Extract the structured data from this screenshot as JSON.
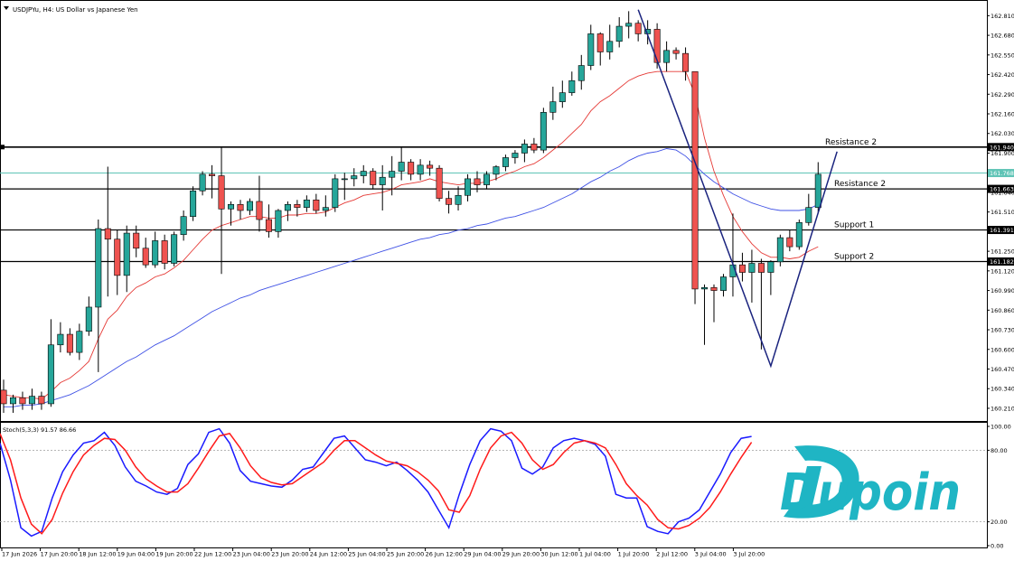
{
  "chart_data": [
    {
      "type": "candlestick",
      "title": "USDJPYu, H4: US Dollar vs Japanese Yen",
      "ylim": [
        160.12,
        162.89
      ],
      "y_ticks": [
        "162.810",
        "162.680",
        "162.550",
        "162.420",
        "162.290",
        "162.160",
        "162.030",
        "161.900",
        "161.640",
        "161.510",
        "161.380",
        "161.250",
        "161.120",
        "160.990",
        "160.860",
        "160.730",
        "160.600",
        "160.470",
        "160.340",
        "160.210"
      ],
      "x_ticks": [
        "17 Jun 2026",
        "17 Jun 20:00",
        "18 Jun 12:00",
        "19 Jun 04:00",
        "19 Jun 20:00",
        "22 Jun 12:00",
        "23 Jun 04:00",
        "23 Jun 20:00",
        "24 Jun 12:00",
        "25 Jun 04:00",
        "25 Jun 20:00",
        "26 Jun 12:00",
        "29 Jun 04:00",
        "29 Jun 20:00",
        "30 Jun 12:00",
        "1 Jul 04:00",
        "1 Jul 20:00",
        "2 Jul 12:00",
        "3 Jul 04:00",
        "3 Jul 20:00"
      ],
      "candles": [
        {
          "o": 160.33,
          "h": 160.4,
          "l": 160.18,
          "c": 160.24
        },
        {
          "o": 160.24,
          "h": 160.3,
          "l": 160.18,
          "c": 160.28
        },
        {
          "o": 160.28,
          "h": 160.32,
          "l": 160.2,
          "c": 160.24
        },
        {
          "o": 160.24,
          "h": 160.34,
          "l": 160.2,
          "c": 160.29
        },
        {
          "o": 160.29,
          "h": 160.32,
          "l": 160.2,
          "c": 160.24
        },
        {
          "o": 160.24,
          "h": 160.8,
          "l": 160.22,
          "c": 160.63
        },
        {
          "o": 160.63,
          "h": 160.78,
          "l": 160.58,
          "c": 160.7
        },
        {
          "o": 160.7,
          "h": 160.74,
          "l": 160.56,
          "c": 160.58
        },
        {
          "o": 160.58,
          "h": 160.77,
          "l": 160.53,
          "c": 160.72
        },
        {
          "o": 160.72,
          "h": 160.95,
          "l": 160.69,
          "c": 160.88
        },
        {
          "o": 160.88,
          "h": 161.46,
          "l": 160.45,
          "c": 161.4
        },
        {
          "o": 161.4,
          "h": 161.81,
          "l": 160.95,
          "c": 161.33
        },
        {
          "o": 161.33,
          "h": 161.39,
          "l": 160.96,
          "c": 161.09
        },
        {
          "o": 161.09,
          "h": 161.42,
          "l": 160.98,
          "c": 161.37
        },
        {
          "o": 161.37,
          "h": 161.42,
          "l": 161.21,
          "c": 161.27
        },
        {
          "o": 161.27,
          "h": 161.34,
          "l": 161.14,
          "c": 161.16
        },
        {
          "o": 161.16,
          "h": 161.38,
          "l": 161.14,
          "c": 161.32
        },
        {
          "o": 161.32,
          "h": 161.36,
          "l": 161.13,
          "c": 161.17
        },
        {
          "o": 161.17,
          "h": 161.38,
          "l": 161.15,
          "c": 161.36
        },
        {
          "o": 161.36,
          "h": 161.52,
          "l": 161.32,
          "c": 161.48
        },
        {
          "o": 161.48,
          "h": 161.68,
          "l": 161.45,
          "c": 161.65
        },
        {
          "o": 161.65,
          "h": 161.78,
          "l": 161.62,
          "c": 161.76
        },
        {
          "o": 161.76,
          "h": 161.82,
          "l": 161.6,
          "c": 161.75
        },
        {
          "o": 161.75,
          "h": 161.94,
          "l": 161.1,
          "c": 161.53
        },
        {
          "o": 161.53,
          "h": 161.58,
          "l": 161.42,
          "c": 161.56
        },
        {
          "o": 161.56,
          "h": 161.59,
          "l": 161.46,
          "c": 161.52
        },
        {
          "o": 161.52,
          "h": 161.6,
          "l": 161.49,
          "c": 161.58
        },
        {
          "o": 161.58,
          "h": 161.75,
          "l": 161.38,
          "c": 161.46
        },
        {
          "o": 161.46,
          "h": 161.56,
          "l": 161.34,
          "c": 161.38
        },
        {
          "o": 161.38,
          "h": 161.53,
          "l": 161.34,
          "c": 161.52
        },
        {
          "o": 161.52,
          "h": 161.58,
          "l": 161.45,
          "c": 161.56
        },
        {
          "o": 161.56,
          "h": 161.59,
          "l": 161.48,
          "c": 161.54
        },
        {
          "o": 161.54,
          "h": 161.62,
          "l": 161.51,
          "c": 161.59
        },
        {
          "o": 161.59,
          "h": 161.63,
          "l": 161.5,
          "c": 161.52
        },
        {
          "o": 161.52,
          "h": 161.62,
          "l": 161.48,
          "c": 161.54
        },
        {
          "o": 161.54,
          "h": 161.76,
          "l": 161.51,
          "c": 161.73
        },
        {
          "o": 161.73,
          "h": 161.77,
          "l": 161.59,
          "c": 161.73
        },
        {
          "o": 161.73,
          "h": 161.8,
          "l": 161.68,
          "c": 161.75
        },
        {
          "o": 161.75,
          "h": 161.82,
          "l": 161.7,
          "c": 161.78
        },
        {
          "o": 161.78,
          "h": 161.8,
          "l": 161.66,
          "c": 161.69
        },
        {
          "o": 161.69,
          "h": 161.82,
          "l": 161.52,
          "c": 161.74
        },
        {
          "o": 161.74,
          "h": 161.88,
          "l": 161.62,
          "c": 161.78
        },
        {
          "o": 161.78,
          "h": 161.94,
          "l": 161.72,
          "c": 161.84
        },
        {
          "o": 161.84,
          "h": 161.86,
          "l": 161.72,
          "c": 161.76
        },
        {
          "o": 161.76,
          "h": 161.86,
          "l": 161.72,
          "c": 161.82
        },
        {
          "o": 161.82,
          "h": 161.85,
          "l": 161.75,
          "c": 161.8
        },
        {
          "o": 161.8,
          "h": 161.82,
          "l": 161.58,
          "c": 161.6
        },
        {
          "o": 161.6,
          "h": 161.65,
          "l": 161.5,
          "c": 161.56
        },
        {
          "o": 161.56,
          "h": 161.68,
          "l": 161.52,
          "c": 161.62
        },
        {
          "o": 161.62,
          "h": 161.76,
          "l": 161.58,
          "c": 161.73
        },
        {
          "o": 161.73,
          "h": 161.78,
          "l": 161.64,
          "c": 161.69
        },
        {
          "o": 161.69,
          "h": 161.78,
          "l": 161.66,
          "c": 161.76
        },
        {
          "o": 161.76,
          "h": 161.82,
          "l": 161.72,
          "c": 161.81
        },
        {
          "o": 161.81,
          "h": 161.89,
          "l": 161.78,
          "c": 161.87
        },
        {
          "o": 161.87,
          "h": 161.92,
          "l": 161.83,
          "c": 161.9
        },
        {
          "o": 161.9,
          "h": 161.99,
          "l": 161.84,
          "c": 161.96
        },
        {
          "o": 161.96,
          "h": 162.0,
          "l": 161.9,
          "c": 161.92
        },
        {
          "o": 161.92,
          "h": 162.2,
          "l": 161.9,
          "c": 162.17
        },
        {
          "o": 162.17,
          "h": 162.34,
          "l": 162.12,
          "c": 162.24
        },
        {
          "o": 162.24,
          "h": 162.38,
          "l": 162.2,
          "c": 162.3
        },
        {
          "o": 162.3,
          "h": 162.44,
          "l": 162.28,
          "c": 162.38
        },
        {
          "o": 162.38,
          "h": 162.55,
          "l": 162.32,
          "c": 162.48
        },
        {
          "o": 162.48,
          "h": 162.75,
          "l": 162.45,
          "c": 162.69
        },
        {
          "o": 162.69,
          "h": 162.7,
          "l": 162.48,
          "c": 162.57
        },
        {
          "o": 162.57,
          "h": 162.75,
          "l": 162.52,
          "c": 162.64
        },
        {
          "o": 162.64,
          "h": 162.8,
          "l": 162.6,
          "c": 162.74
        },
        {
          "o": 162.74,
          "h": 162.84,
          "l": 162.66,
          "c": 162.76
        },
        {
          "o": 162.76,
          "h": 162.78,
          "l": 162.64,
          "c": 162.69
        },
        {
          "o": 162.69,
          "h": 162.78,
          "l": 162.62,
          "c": 162.72
        },
        {
          "o": 162.72,
          "h": 162.76,
          "l": 162.46,
          "c": 162.5
        },
        {
          "o": 162.5,
          "h": 162.64,
          "l": 162.44,
          "c": 162.58
        },
        {
          "o": 162.58,
          "h": 162.6,
          "l": 162.52,
          "c": 162.56
        },
        {
          "o": 162.56,
          "h": 162.6,
          "l": 162.38,
          "c": 162.44
        },
        {
          "o": 162.44,
          "h": 162.4,
          "l": 160.9,
          "c": 161.0
        },
        {
          "o": 161.0,
          "h": 161.03,
          "l": 160.63,
          "c": 161.01
        },
        {
          "o": 161.01,
          "h": 161.03,
          "l": 160.78,
          "c": 160.99
        },
        {
          "o": 160.99,
          "h": 161.1,
          "l": 160.95,
          "c": 161.08
        },
        {
          "o": 161.08,
          "h": 161.5,
          "l": 160.95,
          "c": 161.16
        },
        {
          "o": 161.16,
          "h": 161.24,
          "l": 161.05,
          "c": 161.11
        },
        {
          "o": 161.11,
          "h": 161.26,
          "l": 160.91,
          "c": 161.17
        },
        {
          "o": 161.17,
          "h": 161.2,
          "l": 160.6,
          "c": 161.11
        },
        {
          "o": 161.11,
          "h": 161.19,
          "l": 160.96,
          "c": 161.18
        },
        {
          "o": 161.18,
          "h": 161.36,
          "l": 161.15,
          "c": 161.34
        },
        {
          "o": 161.34,
          "h": 161.39,
          "l": 161.25,
          "c": 161.28
        },
        {
          "o": 161.28,
          "h": 161.46,
          "l": 161.26,
          "c": 161.44
        },
        {
          "o": 161.44,
          "h": 161.63,
          "l": 161.42,
          "c": 161.54
        },
        {
          "o": 161.54,
          "h": 161.84,
          "l": 161.5,
          "c": 161.76
        }
      ],
      "ema_fast": [
        160.3,
        160.29,
        160.28,
        160.28,
        160.27,
        160.32,
        160.38,
        160.41,
        160.46,
        160.52,
        160.67,
        160.8,
        160.86,
        160.95,
        161.01,
        161.04,
        161.08,
        161.1,
        161.14,
        161.19,
        161.26,
        161.33,
        161.39,
        161.42,
        161.44,
        161.46,
        161.48,
        161.48,
        161.47,
        161.47,
        161.49,
        161.49,
        161.5,
        161.5,
        161.51,
        161.54,
        161.57,
        161.59,
        161.62,
        161.63,
        161.64,
        161.66,
        161.69,
        161.7,
        161.71,
        161.73,
        161.71,
        161.7,
        161.69,
        161.7,
        161.7,
        161.71,
        161.73,
        161.76,
        161.78,
        161.81,
        161.83,
        161.87,
        161.92,
        161.97,
        162.03,
        162.09,
        162.18,
        162.24,
        162.28,
        162.33,
        162.38,
        162.41,
        162.43,
        162.44,
        162.44,
        162.44,
        162.44,
        162.29,
        162.0,
        161.78,
        161.62,
        161.48,
        161.38,
        161.3,
        161.24,
        161.21,
        161.21,
        161.2,
        161.21,
        161.25,
        161.28
      ],
      "ema_slow": [
        160.22,
        160.22,
        160.23,
        160.23,
        160.24,
        160.26,
        160.28,
        160.3,
        160.33,
        160.36,
        160.4,
        160.44,
        160.48,
        160.52,
        160.55,
        160.59,
        160.63,
        160.66,
        160.69,
        160.73,
        160.77,
        160.81,
        160.85,
        160.88,
        160.91,
        160.94,
        160.96,
        160.99,
        161.01,
        161.03,
        161.05,
        161.07,
        161.09,
        161.11,
        161.13,
        161.15,
        161.17,
        161.19,
        161.21,
        161.23,
        161.25,
        161.27,
        161.29,
        161.31,
        161.33,
        161.34,
        161.36,
        161.37,
        161.39,
        161.4,
        161.42,
        161.43,
        161.45,
        161.47,
        161.48,
        161.5,
        161.52,
        161.54,
        161.57,
        161.6,
        161.63,
        161.67,
        161.71,
        161.74,
        161.78,
        161.81,
        161.85,
        161.88,
        161.9,
        161.91,
        161.93,
        161.92,
        161.88,
        161.82,
        161.76,
        161.71,
        161.67,
        161.63,
        161.6,
        161.57,
        161.55,
        161.53,
        161.52,
        161.52,
        161.52,
        161.53,
        161.56
      ],
      "horizontal_lines": [
        {
          "label": "Resistance 2",
          "price": 161.94,
          "price_label": "161.940"
        },
        {
          "label": "",
          "price": 161.768,
          "price_label": "161.768"
        },
        {
          "label": "Resistance 2",
          "price": 161.663,
          "price_label": "161.663"
        },
        {
          "label": "Support 1",
          "price": 161.391,
          "price_label": "161.391"
        },
        {
          "label": "Support 2",
          "price": 161.182,
          "price_label": "161.182"
        }
      ],
      "pattern_points": [
        [
          67,
          162.85
        ],
        [
          81,
          160.49
        ],
        [
          88,
          161.91
        ]
      ],
      "colors": {
        "bull": "#26a69a",
        "bear": "#ef5350",
        "ema_fast": "#e53935",
        "ema_slow": "#3f51e5",
        "pattern": "#1a237e",
        "hline": "#000000",
        "current_price": "#5fc4b6"
      }
    },
    {
      "type": "line",
      "title": "Stoch(5,3,3) 91.57 86.66",
      "ylim": [
        0,
        100
      ],
      "y_ticks": [
        "100.00",
        "80.00",
        "20.00",
        "0.00"
      ],
      "levels": [
        80,
        20
      ],
      "series": [
        {
          "values": [
            86,
            55,
            15,
            8,
            12,
            40,
            62,
            76,
            86,
            88,
            95,
            84,
            66,
            54,
            50,
            45,
            43,
            48,
            68,
            77,
            95,
            98,
            86,
            63,
            54,
            52,
            50,
            49,
            55,
            64,
            66,
            78,
            90,
            92,
            82,
            72,
            70,
            67,
            70,
            63,
            55,
            45,
            30,
            15,
            43,
            68,
            88,
            98,
            96,
            88,
            65,
            60,
            66,
            82,
            88,
            90,
            88,
            85,
            75,
            43,
            40,
            40,
            16,
            12,
            10,
            20,
            23,
            30,
            45,
            60,
            78,
            90,
            91.57
          ]
        },
        {
          "values": [
            94,
            72,
            40,
            18,
            10,
            22,
            44,
            62,
            76,
            84,
            90,
            89,
            80,
            66,
            56,
            50,
            45,
            45,
            52,
            65,
            79,
            92,
            94,
            82,
            67,
            57,
            53,
            51,
            52,
            58,
            64,
            70,
            80,
            88,
            88,
            82,
            76,
            71,
            69,
            67,
            62,
            55,
            46,
            30,
            28,
            42,
            64,
            82,
            92,
            95,
            86,
            72,
            64,
            68,
            78,
            86,
            88,
            86,
            82,
            68,
            52,
            42,
            34,
            22,
            15,
            14,
            17,
            23,
            32,
            45,
            60,
            74,
            86.66
          ]
        }
      ]
    }
  ],
  "logo_text": "Dupoin"
}
